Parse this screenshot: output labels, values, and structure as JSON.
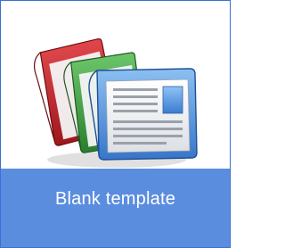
{
  "template_tile": {
    "label": "Blank template",
    "icon": "blank-template-documents-icon",
    "colors": {
      "label_background": "#5b8ddf",
      "label_text": "#ffffff",
      "border": "#3b6fd4",
      "doc_red": "#c0262b",
      "doc_green": "#3b9a3e",
      "doc_blue": "#4d8fdc"
    }
  }
}
